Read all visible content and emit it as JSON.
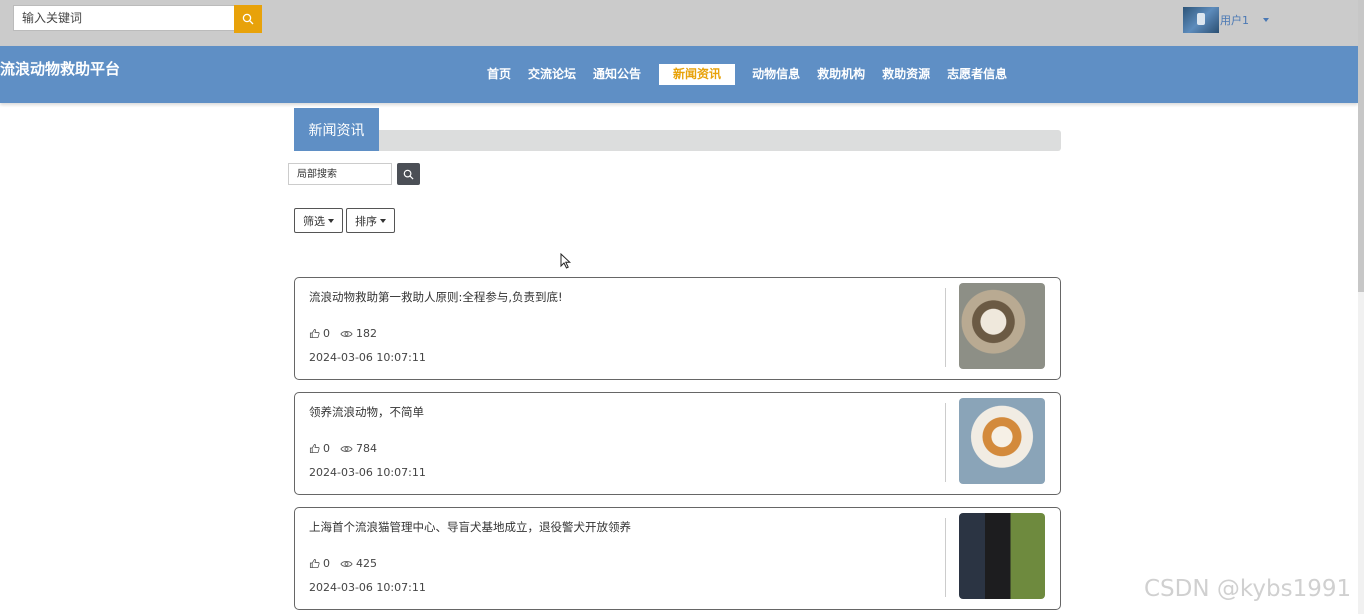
{
  "header": {
    "search_placeholder": "输入关键词",
    "user_name": "用户1"
  },
  "brand": "流浪动物救助平台",
  "nav": {
    "items": [
      {
        "label": "首页"
      },
      {
        "label": "交流论坛"
      },
      {
        "label": "通知公告"
      },
      {
        "label": "新闻资讯",
        "active": true
      },
      {
        "label": "动物信息"
      },
      {
        "label": "救助机构"
      },
      {
        "label": "救助资源"
      },
      {
        "label": "志愿者信息"
      }
    ]
  },
  "section": {
    "title": "新闻资讯",
    "local_search_placeholder": "局部搜索",
    "filter_label": "筛选",
    "sort_label": "排序"
  },
  "news": [
    {
      "title": "流浪动物救助第一救助人原则:全程参与,负责到底!",
      "likes": "0",
      "views": "182",
      "date": "2024-03-06 10:07:11",
      "thumb": "cat"
    },
    {
      "title": "领养流浪动物，不简单",
      "likes": "0",
      "views": "784",
      "date": "2024-03-06 10:07:11",
      "thumb": "chihuahua"
    },
    {
      "title": "上海首个流浪猫管理中心、导盲犬基地成立，退役警犬开放领养",
      "likes": "0",
      "views": "425",
      "date": "2024-03-06 10:07:11",
      "thumb": "police-dog"
    }
  ],
  "watermark": "CSDN @kybs1991",
  "colors": {
    "nav_blue": "#5f8fc5",
    "accent_orange": "#e8a20a",
    "top_gray": "#cbcbcb"
  }
}
